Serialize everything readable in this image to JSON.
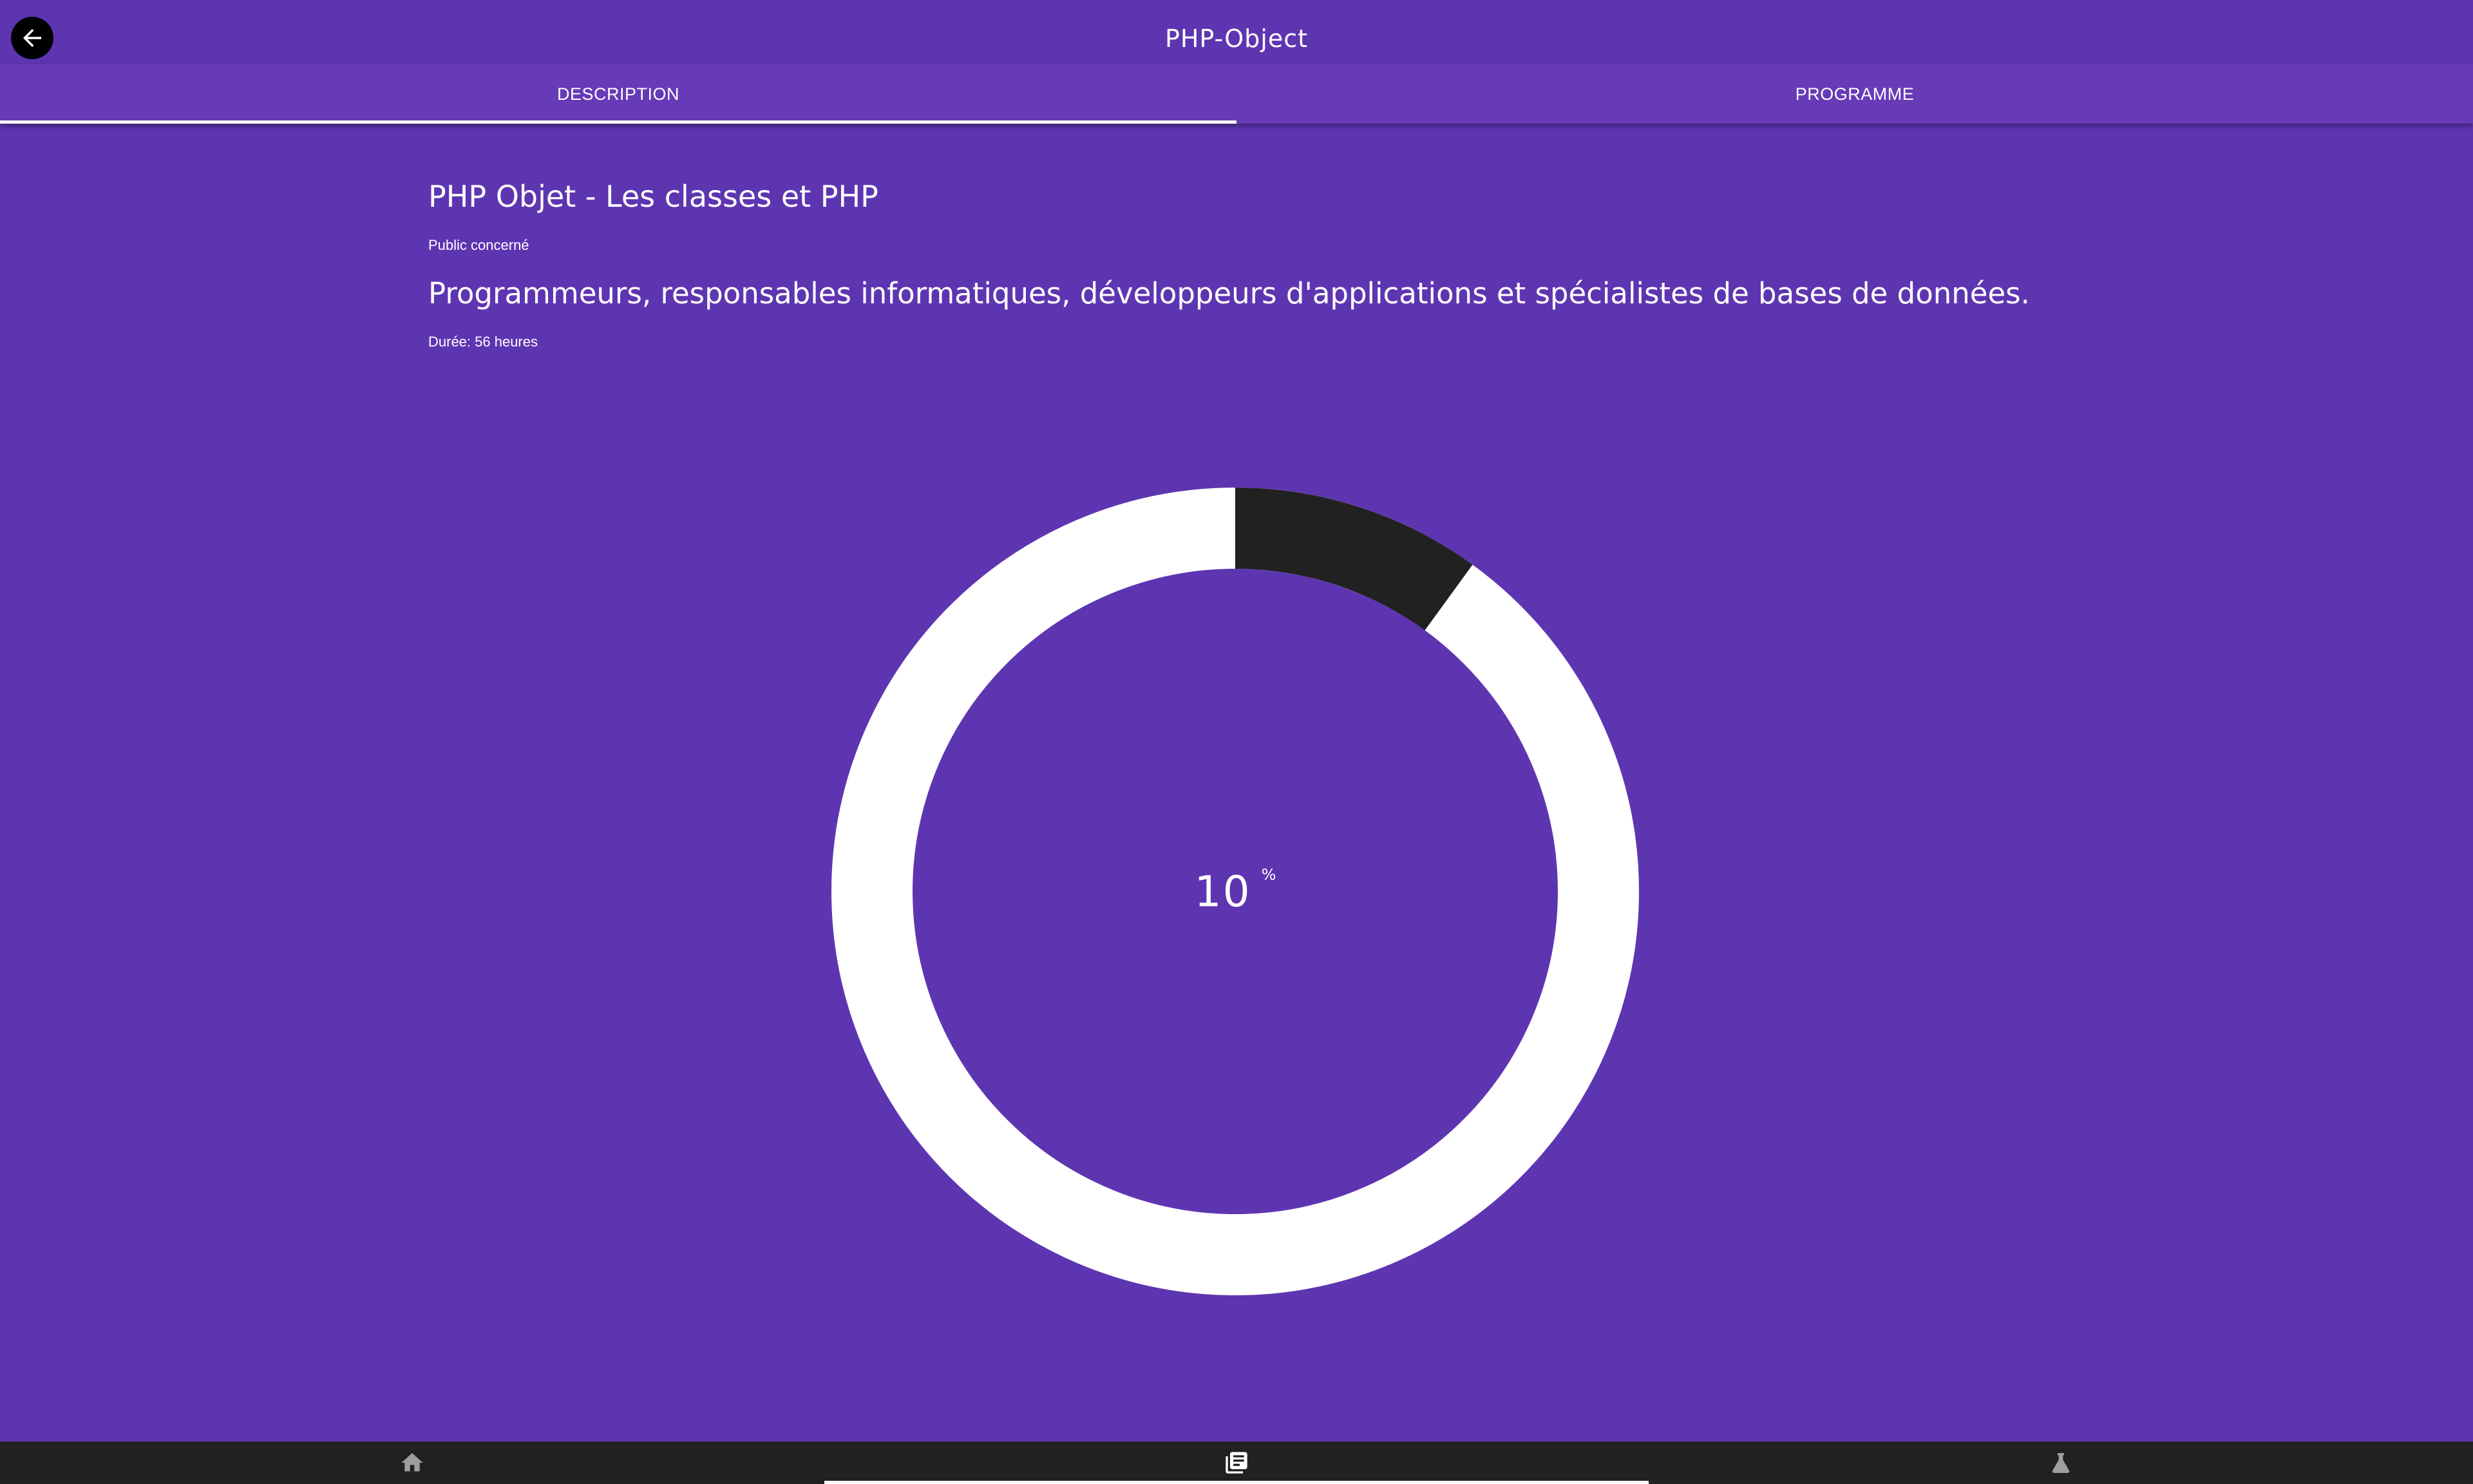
{
  "appbar": {
    "title": "PHP-Object"
  },
  "tabs": [
    {
      "label": "DESCRIPTION",
      "active": true
    },
    {
      "label": "PROGRAMME",
      "active": false
    }
  ],
  "course": {
    "title": "PHP Objet - Les classes et PHP",
    "audience_label": "Public concerné",
    "audience_text": "Programmeurs, responsables informatiques, développeurs d'applications et spécialistes de bases de données.",
    "duration": "Durée: 56 heures"
  },
  "progress": {
    "value": "10",
    "unit": "%",
    "fraction": 0.1,
    "track_color": "#ffffff",
    "fill_color": "#212121"
  },
  "bottom_nav": {
    "items": [
      {
        "icon": "home-icon",
        "active": false
      },
      {
        "icon": "library-books-icon",
        "active": true
      },
      {
        "icon": "flask-icon",
        "active": false
      }
    ]
  },
  "colors": {
    "background": "#5e35b1",
    "tab_bar": "#673ab7",
    "bottom_nav": "#212121"
  }
}
